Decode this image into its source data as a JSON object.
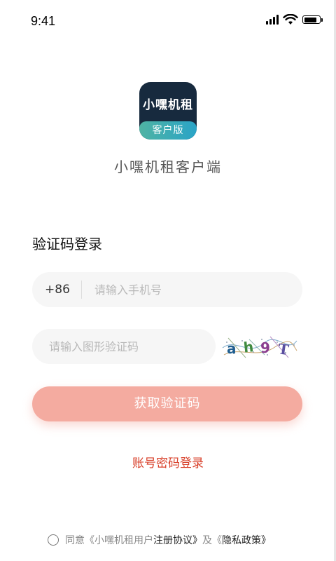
{
  "status_bar": {
    "time": "9:41",
    "battery_level": 0.9
  },
  "app": {
    "icon_name": "小嘿机租",
    "icon_badge": "客户版",
    "title": "小嘿机租客户端"
  },
  "login": {
    "heading": "验证码登录",
    "country_code": "+86",
    "phone_placeholder": "请输入手机号",
    "captcha_placeholder": "请输入图形验证码",
    "captcha_text": [
      "a",
      "h",
      "9",
      "T"
    ],
    "get_code_label": "获取验证码",
    "password_login_label": "账号密码登录"
  },
  "agreement": {
    "agree_prefix": "同意",
    "user_agreement_a": "《小嘿机租用户",
    "user_agreement_b": "注册协议》",
    "and": "及",
    "privacy_a": "《",
    "privacy_b": "隐私政策》"
  },
  "colors": {
    "primary_button": "#f4aba0",
    "link": "#d8402a",
    "icon_bg": "#172a3e"
  }
}
